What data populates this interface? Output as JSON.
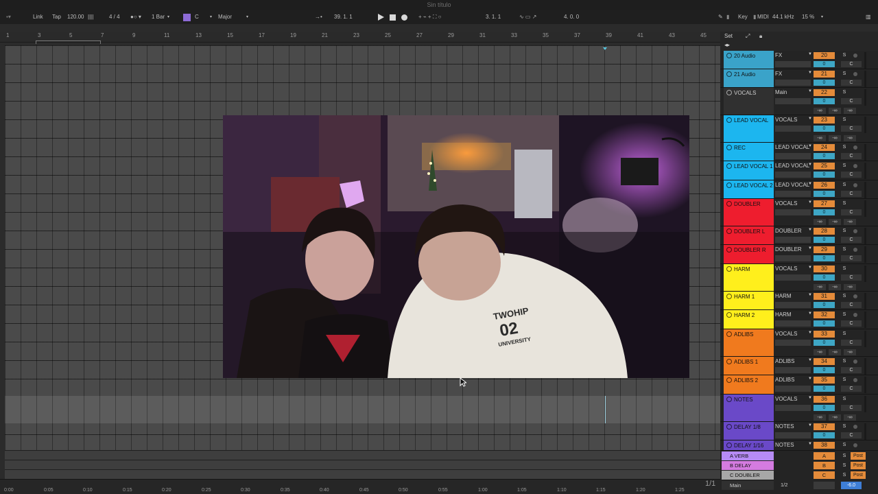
{
  "window": {
    "title": "Sin título"
  },
  "controls": {
    "link": "Link",
    "tap": "Tap",
    "tempo": "120.00",
    "time_sig": "4 / 4",
    "quantize": "1 Bar",
    "key": "C",
    "scale": "Major",
    "position": "39.  1.  1",
    "loop_start": "3.  1.  1",
    "loop_length": "4.  0.  0",
    "key_label": "Key",
    "midi_label": "MIDI",
    "sample_rate": "44.1 kHz",
    "cpu": "15 %"
  },
  "ruler": {
    "bars": [
      "1",
      "3",
      "5",
      "7",
      "9",
      "11",
      "13",
      "15",
      "17",
      "19",
      "21",
      "23",
      "25",
      "27",
      "29",
      "31",
      "33",
      "35",
      "37",
      "39",
      "41",
      "43",
      "45"
    ]
  },
  "timeline": {
    "times": [
      "0:00",
      "0:05",
      "0:10",
      "0:15",
      "0:20",
      "0:25",
      "0:30",
      "0:35",
      "0:40",
      "0:45",
      "0:50",
      "0:55",
      "1:00",
      "1:05",
      "1:10",
      "1:15",
      "1:20",
      "1:25"
    ],
    "page": "1/1"
  },
  "video": {
    "hoodie_text_1": "TWOHIP",
    "hoodie_text_2": "02",
    "hoodie_text_3": "UNIVERSITY"
  },
  "mixer": {
    "set_label": "Set",
    "tracks": [
      {
        "name": "20 Audio",
        "route": "FX",
        "num": "20",
        "vol": "0",
        "pan": "C",
        "color": "#3aa3c9",
        "height": 27,
        "group": false,
        "sends": false
      },
      {
        "name": "21 Audio",
        "route": "FX",
        "num": "21",
        "vol": "0",
        "pan": "C",
        "color": "#3aa3c9",
        "height": 27,
        "group": false,
        "sends": false
      },
      {
        "name": "VOCALS",
        "route": "Main",
        "num": "22",
        "vol": "0",
        "pan": "C",
        "color": "#303030",
        "height": 40,
        "group": true,
        "sends": true,
        "light": true
      },
      {
        "name": "LEAD VOCAL",
        "route": "VOCALS",
        "num": "23",
        "vol": "0",
        "pan": "C",
        "color": "#1cb6ef",
        "height": 40,
        "group": true,
        "sends": true
      },
      {
        "name": "REC",
        "route": "LEAD VOCAL",
        "num": "24",
        "vol": "0",
        "pan": "C",
        "color": "#1cb6ef",
        "height": 27,
        "group": false,
        "sends": false
      },
      {
        "name": "LEAD VOCAL 1",
        "route": "LEAD VOCAL",
        "num": "25",
        "vol": "0",
        "pan": "C",
        "color": "#1cb6ef",
        "height": 28,
        "group": false,
        "sends": false
      },
      {
        "name": "LEAD VOCAL 2",
        "route": "LEAD VOCAL",
        "num": "26",
        "vol": "0",
        "pan": "C",
        "color": "#1cb6ef",
        "height": 27,
        "group": false,
        "sends": false
      },
      {
        "name": "DOUBLER",
        "route": "VOCALS",
        "num": "27",
        "vol": "0",
        "pan": "C",
        "color": "#ee1d2e",
        "height": 40,
        "group": true,
        "sends": true
      },
      {
        "name": "DOUBLER L",
        "route": "DOUBLER",
        "num": "28",
        "vol": "0",
        "pan": "C",
        "color": "#ee1d2e",
        "height": 27,
        "group": false,
        "sends": false
      },
      {
        "name": "DOUBLER R",
        "route": "DOUBLER",
        "num": "29",
        "vol": "0",
        "pan": "C",
        "color": "#ee1d2e",
        "height": 28,
        "group": false,
        "sends": false
      },
      {
        "name": "HARM",
        "route": "VOCALS",
        "num": "30",
        "vol": "0",
        "pan": "C",
        "color": "#ffef1c",
        "height": 40,
        "group": true,
        "sends": true
      },
      {
        "name": "HARM 1",
        "route": "HARM",
        "num": "31",
        "vol": "0",
        "pan": "C",
        "color": "#ffef1c",
        "height": 27,
        "group": false,
        "sends": false
      },
      {
        "name": "HARM 2",
        "route": "HARM",
        "num": "32",
        "vol": "0",
        "pan": "C",
        "color": "#ffef1c",
        "height": 28,
        "group": false,
        "sends": false
      },
      {
        "name": "ADLIBS",
        "route": "VOCALS",
        "num": "33",
        "vol": "0",
        "pan": "C",
        "color": "#f07a1e",
        "height": 40,
        "group": true,
        "sends": true
      },
      {
        "name": "ADLIBS 1",
        "route": "ADLIBS",
        "num": "34",
        "vol": "0",
        "pan": "C",
        "color": "#f07a1e",
        "height": 27,
        "group": false,
        "sends": false
      },
      {
        "name": "ADLIBS 2",
        "route": "ADLIBS",
        "num": "35",
        "vol": "0",
        "pan": "C",
        "color": "#f07a1e",
        "height": 28,
        "group": false,
        "sends": false
      },
      {
        "name": "NOTES",
        "route": "VOCALS",
        "num": "36",
        "vol": "0",
        "pan": "C",
        "color": "#6a49c8",
        "height": 40,
        "group": true,
        "sends": true
      },
      {
        "name": "DELAY 1/8",
        "route": "NOTES",
        "num": "37",
        "vol": "0",
        "pan": "C",
        "color": "#6a49c8",
        "height": 27,
        "group": false,
        "sends": false
      },
      {
        "name": "DELAY 1/16",
        "route": "NOTES",
        "num": "38",
        "vol": "0",
        "pan": "C",
        "color": "#6a49c8",
        "height": 15,
        "group": false,
        "sends": false
      }
    ],
    "send_value": "-∞",
    "returns": [
      {
        "name": "A VERB",
        "num": "A",
        "post": "Post",
        "color": "#b68bf5"
      },
      {
        "name": "B DELAY",
        "num": "B",
        "post": "Post",
        "color": "#d47be0"
      },
      {
        "name": "C DOUBLER",
        "num": "C",
        "post": "Post",
        "color": "#a7a7a7"
      }
    ],
    "main": {
      "name": "Main",
      "route": "1/2",
      "vol": "-6.0"
    }
  }
}
